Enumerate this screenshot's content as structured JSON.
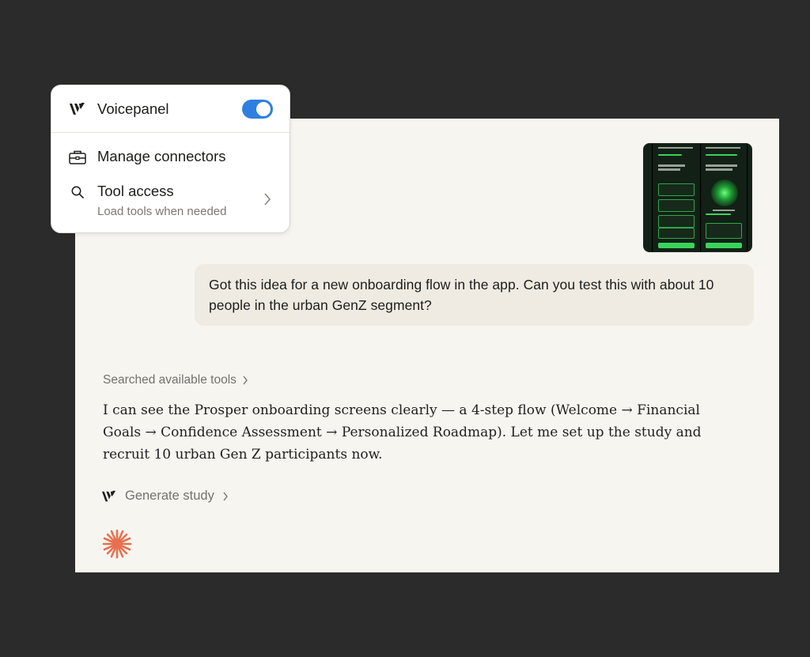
{
  "popover": {
    "title": "Voicepanel",
    "toggle_on": true,
    "toggle_color": "#2f7fe0",
    "items": [
      {
        "label": "Manage connectors",
        "icon": "toolbox-icon"
      },
      {
        "label": "Tool access",
        "sublabel": "Load tools when needed",
        "icon": "search-icon"
      }
    ]
  },
  "chat": {
    "user_message": "Got this idea for a new onboarding flow in the app.  Can you test this with about 10 people in the urban GenZ segment?",
    "tool_status": "Searched available tools",
    "assistant_message": "I can see the Prosper onboarding screens clearly — a 4-step flow (Welcome → Financial Goals → Confidence Assessment → Personalized Roadmap). Let me set up the study and recruit 10 urban Gen Z participants now.",
    "action_label": "Generate study"
  },
  "colors": {
    "background": "#2b2b2b",
    "chat_bg": "#f7f5f0",
    "bubble_bg": "#efebe2",
    "accent_spark": "#e8704f"
  }
}
